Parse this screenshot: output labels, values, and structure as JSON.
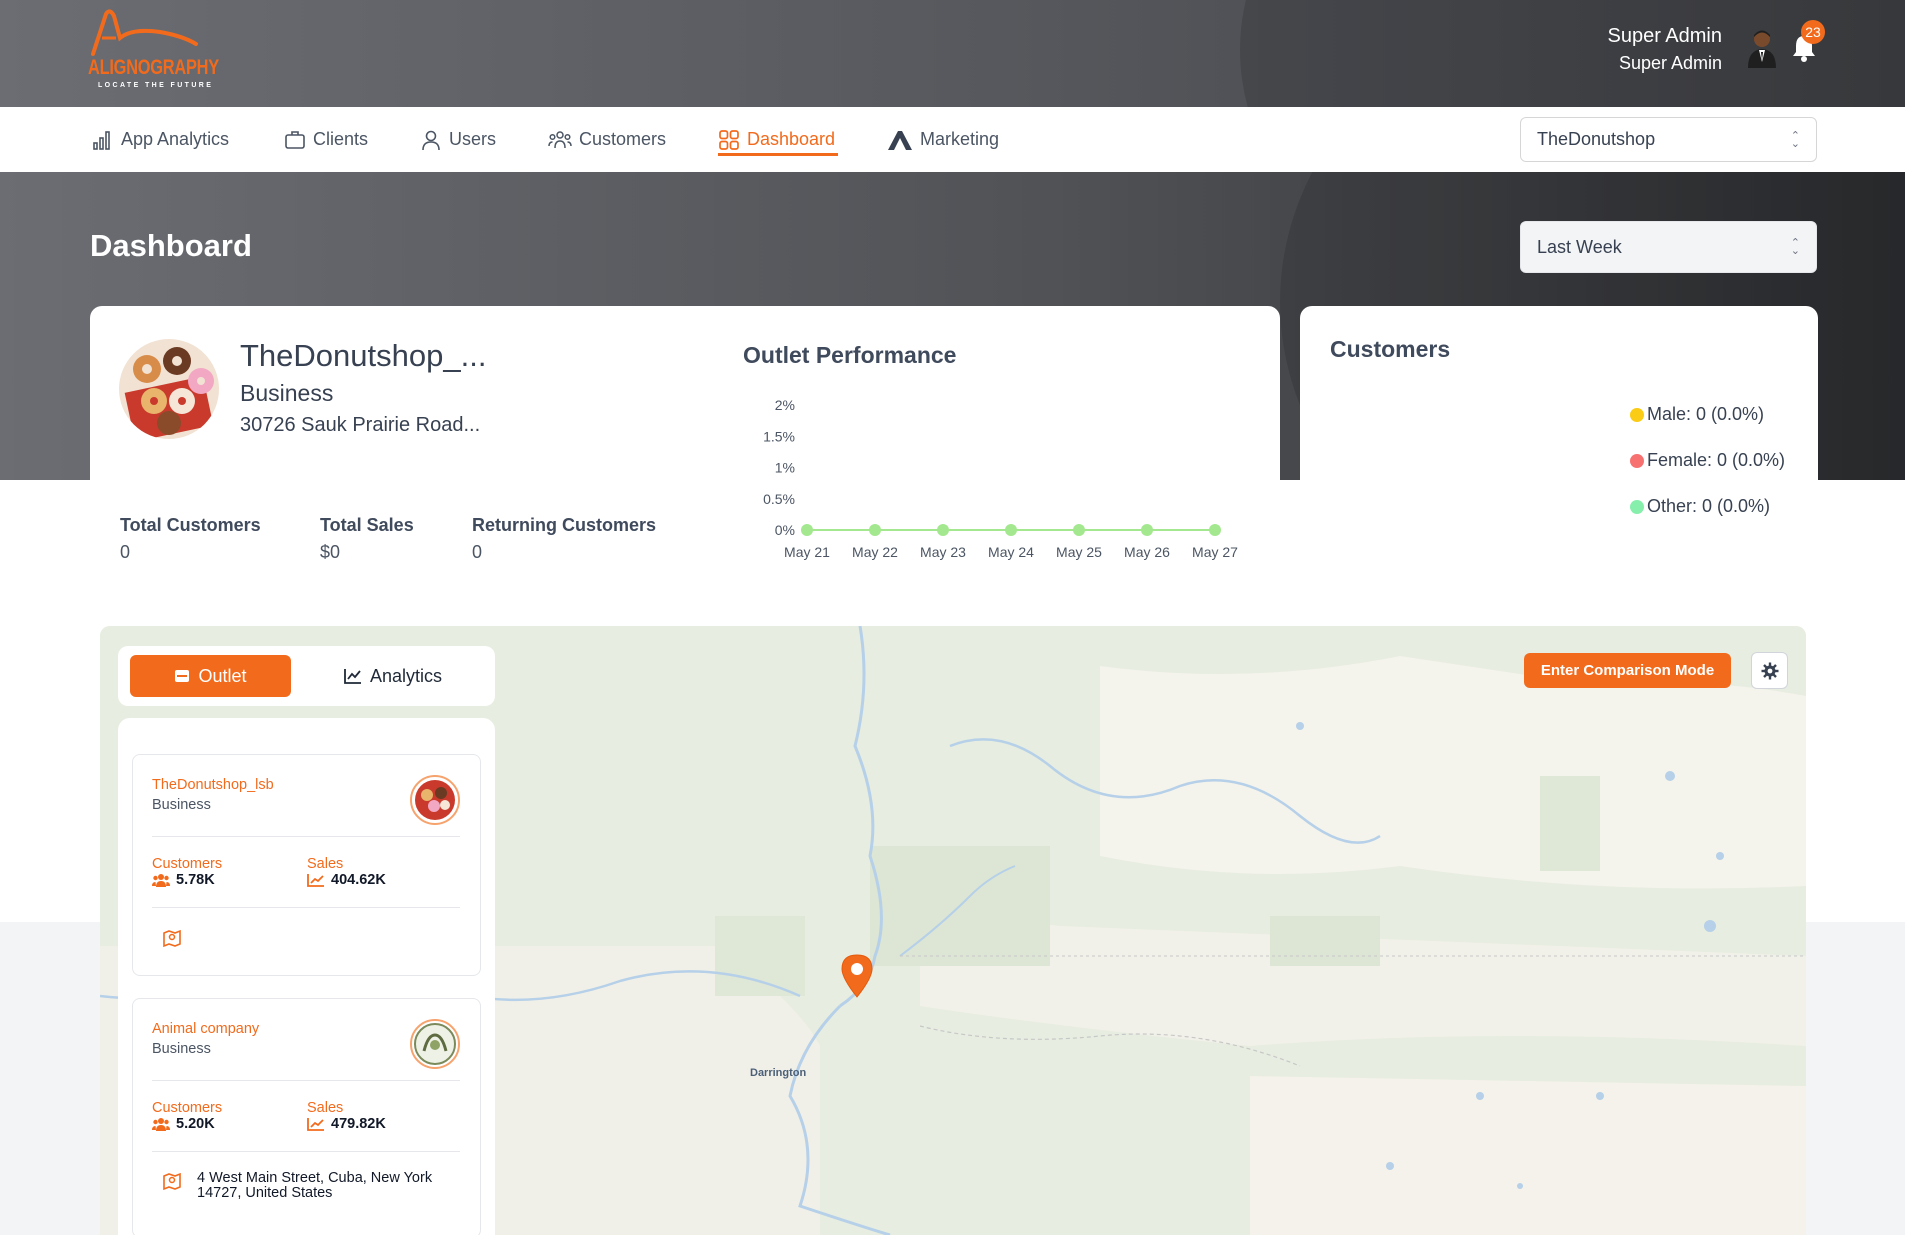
{
  "header": {
    "logo_text": "ALIGNOGRAPHY",
    "logo_tagline": "LOCATE THE FUTURE",
    "user_name": "Super Admin",
    "user_role": "Super Admin",
    "notification_count": "23"
  },
  "nav": {
    "items": [
      {
        "label": "App Analytics",
        "icon": "bar-chart-icon"
      },
      {
        "label": "Clients",
        "icon": "briefcase-icon"
      },
      {
        "label": "Users",
        "icon": "user-icon"
      },
      {
        "label": "Customers",
        "icon": "users-group-icon"
      },
      {
        "label": "Dashboard",
        "icon": "grid-icon",
        "active": true
      },
      {
        "label": "Marketing",
        "icon": "marketing-logo-icon"
      }
    ],
    "business_select": "TheDonutshop"
  },
  "dashboard": {
    "title": "Dashboard",
    "period_select": "Last Week"
  },
  "outlet_summary": {
    "name": "TheDonutshop_...",
    "type": "Business",
    "address": "30726 Sauk Prairie Road...",
    "stats": [
      {
        "label": "Total Customers",
        "value": "0"
      },
      {
        "label": "Total Sales",
        "value": "$0"
      },
      {
        "label": "Returning Customers",
        "value": "0"
      }
    ]
  },
  "outlet_performance": {
    "title": "Outlet Performance"
  },
  "chart_data": {
    "type": "line",
    "title": "Outlet Performance",
    "categories": [
      "May 21",
      "May 22",
      "May 23",
      "May 24",
      "May 25",
      "May 26",
      "May 27"
    ],
    "series": [
      {
        "values": [
          0,
          0,
          0,
          0,
          0,
          0,
          0
        ],
        "color": "#a3e88f"
      }
    ],
    "y_ticks": [
      "0%",
      "0.5%",
      "1%",
      "1.5%",
      "2%"
    ],
    "ylim": [
      0,
      2
    ],
    "grid": false
  },
  "customers_card": {
    "title": "Customers",
    "legend": [
      {
        "label": "Male: 0 (0.0%)",
        "color": "#facc15"
      },
      {
        "label": "Female: 0 (0.0%)",
        "color": "#f87171"
      },
      {
        "label": "Other: 0 (0.0%)",
        "color": "#86efac"
      }
    ]
  },
  "map_panel": {
    "tab_outlet": "Outlet",
    "tab_analytics": "Analytics",
    "comparison_button": "Enter Comparison Mode",
    "town_label": "Darrington",
    "outlets": [
      {
        "name": "TheDonutshop_lsb",
        "type": "Business",
        "customers_label": "Customers",
        "customers_value": "5.78K",
        "sales_label": "Sales",
        "sales_value": "404.62K",
        "address": ""
      },
      {
        "name": "Animal company",
        "type": "Business",
        "customers_label": "Customers",
        "customers_value": "5.20K",
        "sales_label": "Sales",
        "sales_value": "479.82K",
        "address": "4 West Main Street, Cuba, New York 14727, United States"
      }
    ]
  },
  "colors": {
    "accent": "#f26b1d",
    "header_dark": "#55575c",
    "line_green": "#a3e88f"
  }
}
